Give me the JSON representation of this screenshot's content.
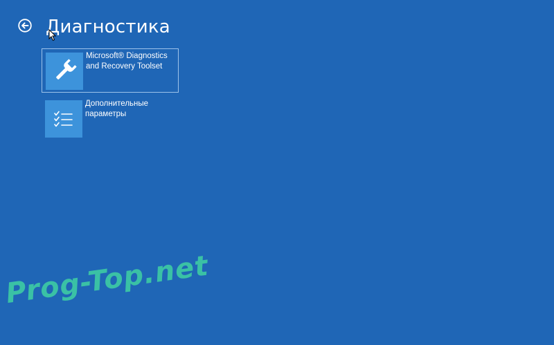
{
  "header": {
    "title": "Диагностика",
    "back_icon": "back-arrow-icon"
  },
  "tiles": [
    {
      "label": "Microsoft® Diagnostics and Recovery Toolset",
      "icon": "wrench-icon",
      "selected": true
    },
    {
      "label": "Дополнительные параметры",
      "icon": "checklist-icon",
      "selected": false
    }
  ],
  "colors": {
    "background": "#1f66b6",
    "tile_icon_bg": "#3d93db",
    "selection_border": "#9ec3ea",
    "watermark": "#3cc6a5"
  },
  "watermark": {
    "text": "Prog-Top.net"
  }
}
